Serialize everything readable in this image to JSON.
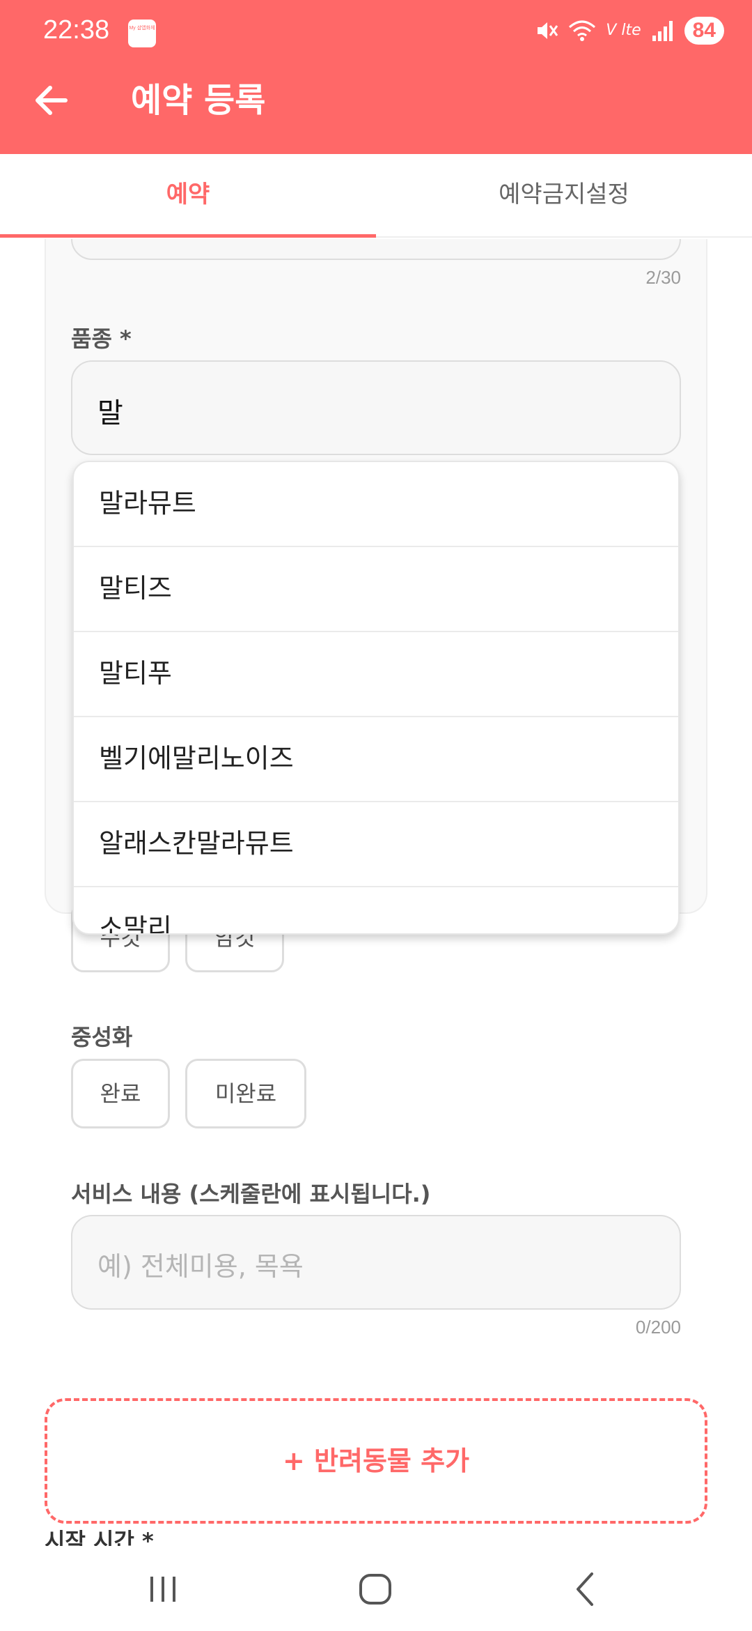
{
  "status_bar": {
    "time": "22:38",
    "app_icon_text": "My 샵앱화체",
    "battery": "84",
    "icons": [
      "mute-icon",
      "wifi-icon",
      "volte-icon",
      "signal-icon"
    ]
  },
  "app_bar": {
    "title": "예약 등록",
    "back_icon": "arrow-left-icon"
  },
  "tabs": [
    {
      "label": "예약",
      "active": true
    },
    {
      "label": "예약금지설정",
      "active": false
    }
  ],
  "form": {
    "name_counter": "2/30",
    "breed": {
      "label": "품종 *",
      "value": "말"
    },
    "breed_suggestions": [
      "말라뮤트",
      "말티즈",
      "말티푸",
      "벨기에말리노이즈",
      "알래스칸말라뮤트",
      "소말리"
    ],
    "sex_options": [
      "수컷",
      "암컷"
    ],
    "neuter": {
      "label": "중성화",
      "options": [
        "완료",
        "미완료"
      ]
    },
    "service": {
      "label": "서비스 내용 (스케줄란에 표시됩니다.)",
      "placeholder": "예) 전체미용, 목욕",
      "counter": "0/200"
    },
    "add_pet_label": "+ 반려동물 추가",
    "next_label": "시작 시간 *"
  },
  "colors": {
    "accent": "#FF6868"
  }
}
